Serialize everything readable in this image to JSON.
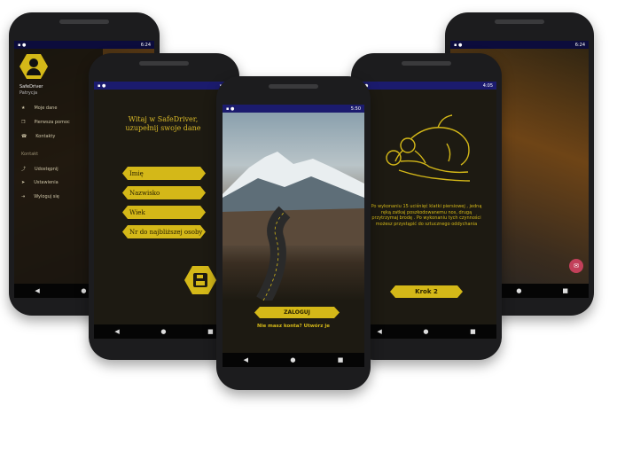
{
  "phones": {
    "back_left": {
      "status_time": "6:24",
      "app_name": "SafeDriver",
      "user_name": "Patrycja",
      "menu": [
        {
          "icon": "star-icon",
          "label": "Moje dane"
        },
        {
          "icon": "copy-icon",
          "label": "Pierwsza pomoc"
        },
        {
          "icon": "phone-icon",
          "label": "Kontakty"
        }
      ],
      "section_label": "Kontakt",
      "menu2": [
        {
          "icon": "share-icon",
          "label": "Udostępnij"
        },
        {
          "icon": "send-icon",
          "label": "Ustawienia"
        },
        {
          "icon": "logout-icon",
          "label": "Wyloguj się"
        }
      ]
    },
    "form": {
      "status_time": "",
      "heading": "Witaj w SafeDriver, uzupełnij swoje dane",
      "fields": [
        "Imię",
        "Nazwisko",
        "Wiek",
        "Nr do najbliższej osoby"
      ],
      "save_icon": "floppy-disk-icon"
    },
    "login": {
      "status_time": "5:50",
      "login_label": "ZALOGUJ",
      "signup_text": "Nie masz konta? Utwórz je"
    },
    "first_aid": {
      "status_time": "4:05",
      "instruction": "Po wykonaniu 15 uciśnięć klatki piersiowej , jedną ręką zatkaj poszkodowanemu nos, drugą przytrzymaj brodę . Po wykonaniu tych czynności możesz przystąpić do sztucznego oddychania",
      "step_label": "Krok 2"
    },
    "back_right": {
      "status_time": "6:24"
    }
  },
  "colors": {
    "accent": "#d4b818",
    "status_bar": "#1b1b6e",
    "dark": "#111111"
  }
}
